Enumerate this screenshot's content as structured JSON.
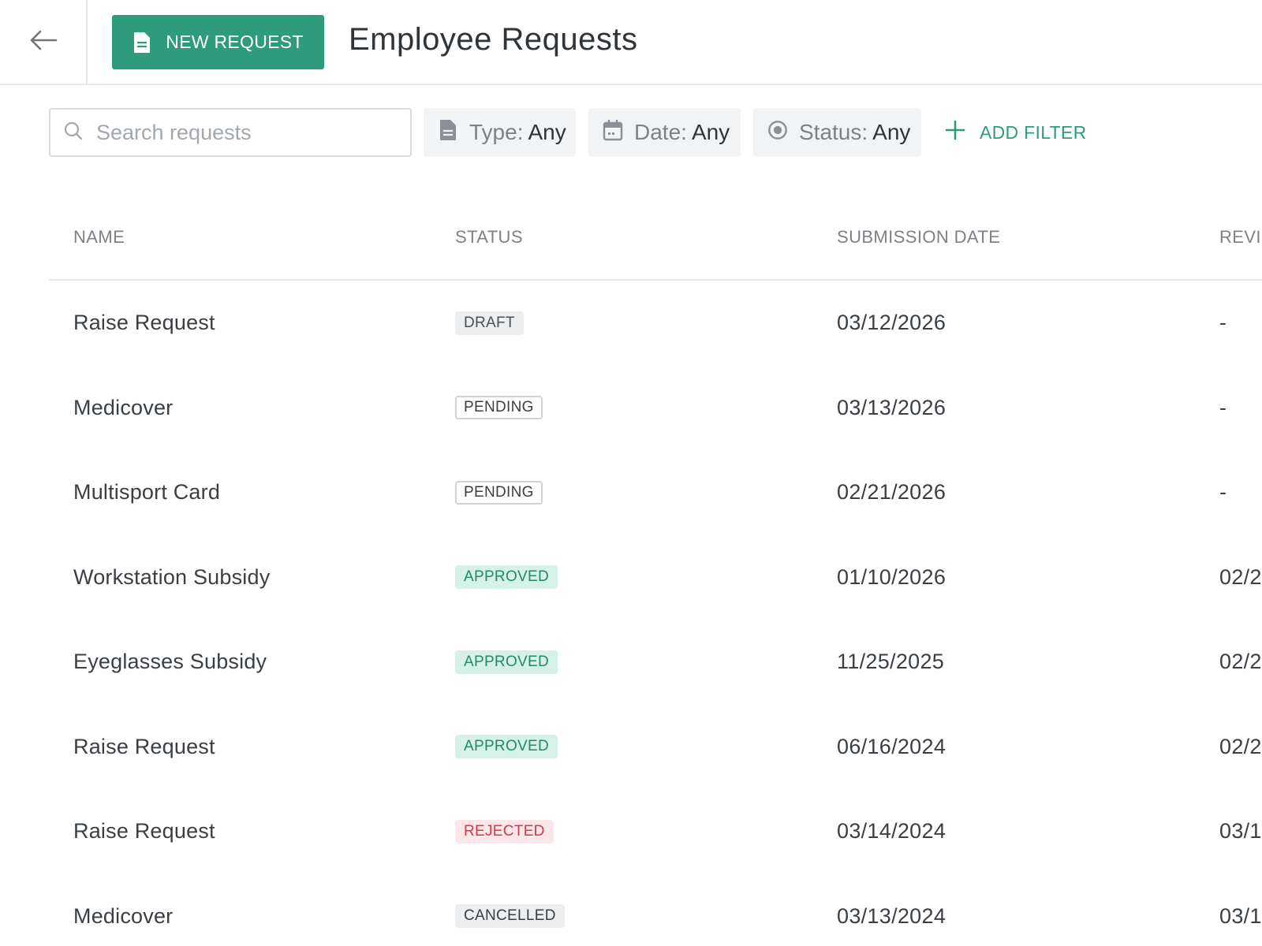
{
  "header": {
    "back_label": "",
    "new_request_label": "NEW REQUEST",
    "title": "Employee Requests"
  },
  "filters": {
    "search_placeholder": "Search requests",
    "search_value": "",
    "type": {
      "label": "Type:",
      "value": "Any"
    },
    "date": {
      "label": "Date:",
      "value": "Any"
    },
    "status": {
      "label": "Status:",
      "value": "Any"
    },
    "add_filter_label": "ADD FILTER"
  },
  "table": {
    "columns": [
      "NAME",
      "STATUS",
      "SUBMISSION DATE",
      "REVIE"
    ],
    "rows": [
      {
        "name": "Raise Request",
        "status": "DRAFT",
        "status_kind": "draft",
        "submission_date": "03/12/2026",
        "review": "-"
      },
      {
        "name": "Medicover",
        "status": "PENDING",
        "status_kind": "pending",
        "submission_date": "03/13/2026",
        "review": "-"
      },
      {
        "name": "Multisport Card",
        "status": "PENDING",
        "status_kind": "pending",
        "submission_date": "02/21/2026",
        "review": "-"
      },
      {
        "name": "Workstation Subsidy",
        "status": "APPROVED",
        "status_kind": "approved",
        "submission_date": "01/10/2026",
        "review": "02/2"
      },
      {
        "name": "Eyeglasses Subsidy",
        "status": "APPROVED",
        "status_kind": "approved",
        "submission_date": "11/25/2025",
        "review": "02/2"
      },
      {
        "name": "Raise Request",
        "status": "APPROVED",
        "status_kind": "approved",
        "submission_date": "06/16/2024",
        "review": "02/2"
      },
      {
        "name": "Raise Request",
        "status": "REJECTED",
        "status_kind": "rejected",
        "submission_date": "03/14/2024",
        "review": "03/1"
      },
      {
        "name": "Medicover",
        "status": "CANCELLED",
        "status_kind": "cancelled",
        "submission_date": "03/13/2024",
        "review": "03/1"
      }
    ]
  },
  "colors": {
    "accent": "#2e9b7c",
    "approved_bg": "#d6f1e7",
    "rejected_text": "#d6384a",
    "divider": "#e6e8ea"
  },
  "icons": {
    "back": "arrow-left-icon",
    "new_request": "document-icon",
    "search": "search-icon",
    "type": "document-icon",
    "date": "calendar-icon",
    "status": "radio-circle-icon",
    "add_filter": "plus-icon"
  }
}
